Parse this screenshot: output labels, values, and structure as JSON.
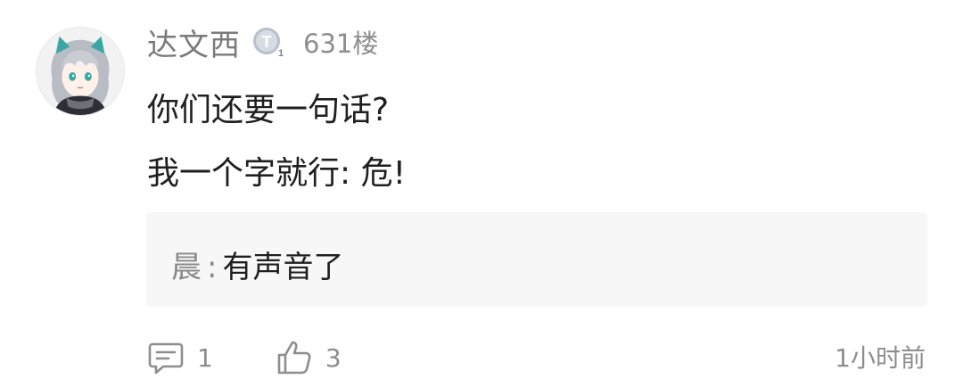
{
  "comment": {
    "username": "达文西",
    "level_badge_letter": "T",
    "level_badge_number": "1",
    "floor": "631楼",
    "content_lines": [
      "你们还要一句话?",
      "我一个字就行: 危!"
    ],
    "reply": {
      "author": "晨",
      "separator": ":",
      "text": "有声音了"
    },
    "actions": {
      "reply_count": "1",
      "like_count": "3",
      "reply_icon": "comment-icon",
      "like_icon": "thumbs-up-icon"
    },
    "timestamp": "1小时前"
  },
  "colors": {
    "meta_text": "#8e8e8e",
    "body_text": "#1f1f1f",
    "reply_bg": "#f7f7f7"
  }
}
